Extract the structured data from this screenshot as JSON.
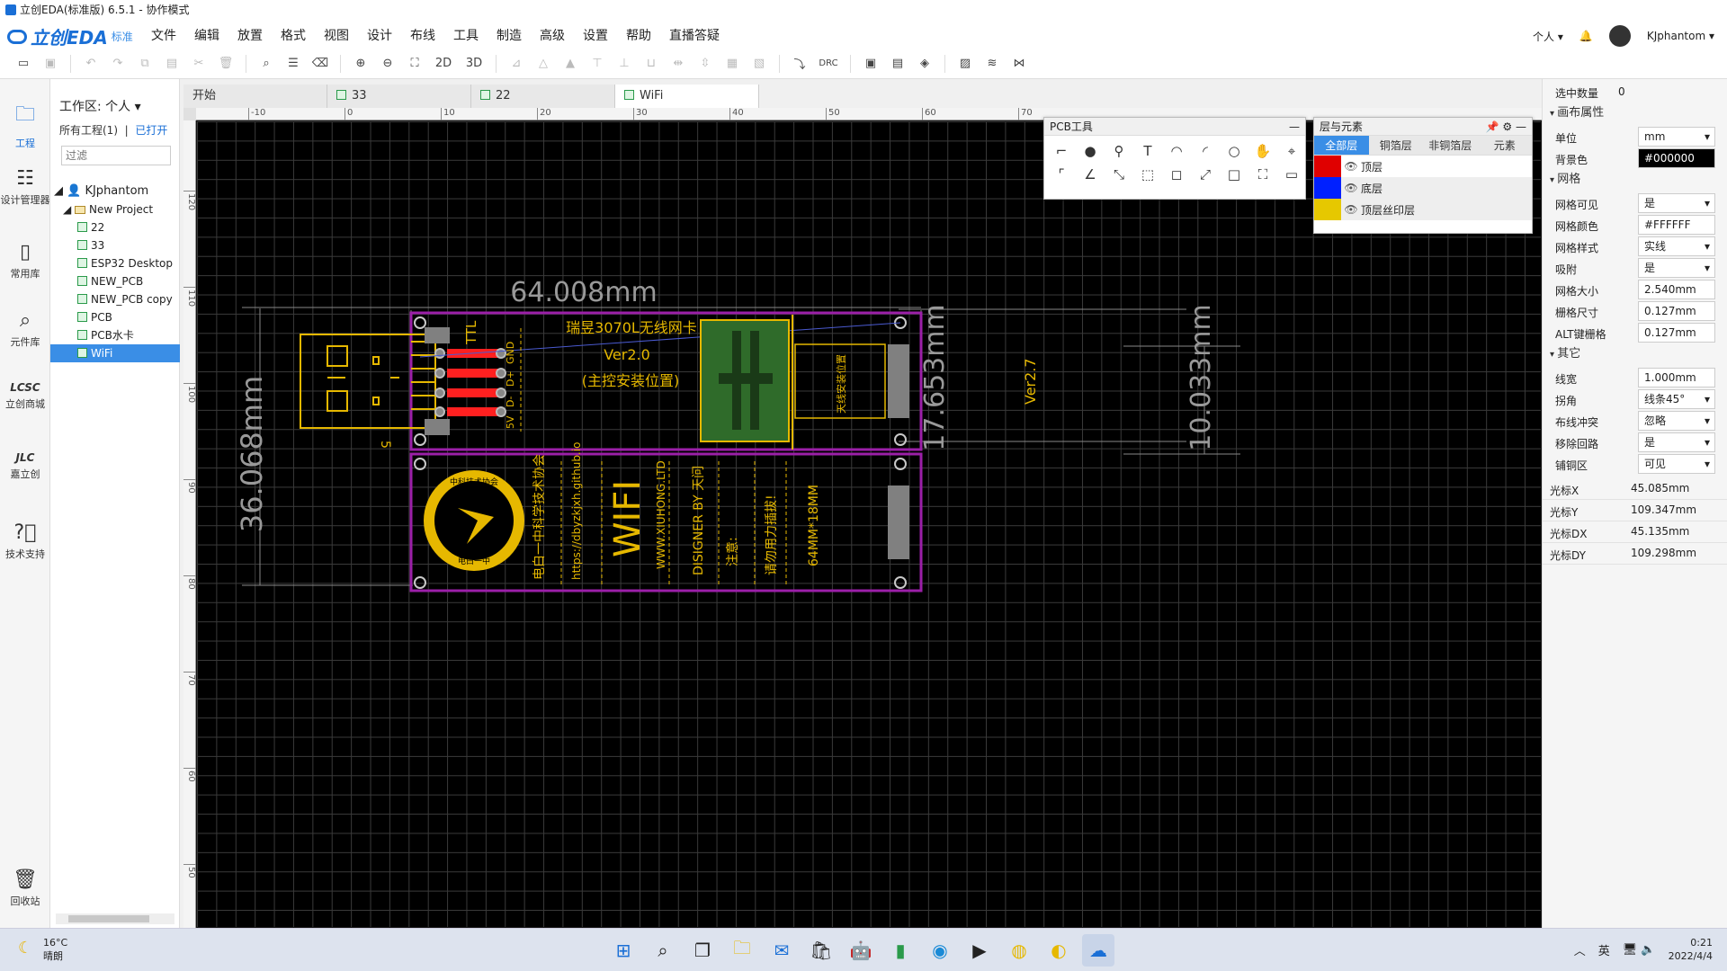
{
  "window": {
    "title": "立创EDA(标准版) 6.5.1 - 协作模式"
  },
  "brand": {
    "name": "立创EDA",
    "edition": "标准"
  },
  "menu": [
    "文件",
    "编辑",
    "放置",
    "格式",
    "视图",
    "设计",
    "布线",
    "工具",
    "制造",
    "高级",
    "设置",
    "帮助",
    "直播答疑"
  ],
  "user": {
    "mode": "个人",
    "name": "KJphantom"
  },
  "toolbar": {
    "view2d": "2D",
    "view3d": "3D",
    "drc": "DRC"
  },
  "leftnav": [
    {
      "id": "project",
      "label": "工程"
    },
    {
      "id": "design-manager",
      "label": "设计管理器"
    },
    {
      "id": "common-lib",
      "label": "常用库"
    },
    {
      "id": "component-lib",
      "label": "元件库"
    },
    {
      "id": "lcsc-mall",
      "label": "立创商城"
    },
    {
      "id": "jlc",
      "label": "嘉立创"
    },
    {
      "id": "support",
      "label": "技术支持"
    },
    {
      "id": "recycle",
      "label": "回收站"
    }
  ],
  "project_panel": {
    "workspace": "工作区: 个人",
    "all_projects": "所有工程(1)",
    "opened": "已打开",
    "filter_placeholder": "过滤",
    "owner": "KJphantom",
    "folder": "New Project",
    "files": [
      "22",
      "33",
      "ESP32 Desktop",
      "NEW_PCB",
      "NEW_PCB copy",
      "PCB",
      "PCB水卡",
      "WiFi"
    ],
    "selected": "WiFi"
  },
  "doc_tabs": [
    {
      "label": "开始",
      "icon": false
    },
    {
      "label": "33",
      "icon": true
    },
    {
      "label": "22",
      "icon": true
    },
    {
      "label": "WiFi",
      "icon": true,
      "active": true
    }
  ],
  "ruler_top": [
    "-10",
    "0",
    "10",
    "20",
    "30",
    "40",
    "50",
    "60",
    "70"
  ],
  "ruler_left": [
    "120",
    "110",
    "100",
    "90",
    "80",
    "70",
    "60",
    "50"
  ],
  "pcb": {
    "dim_width": "64.008mm",
    "dim_height": "36.068mm",
    "dim_right1": "17.653mm",
    "dim_right2": "10.033mm",
    "title": "瑞昱3070L无线网卡",
    "version": "Ver2.0",
    "subtitle": "(主控安装位置)",
    "ver27": "Ver2.7",
    "ttl": "TTL",
    "pins": [
      "GND",
      "D+",
      "D-",
      "5V"
    ],
    "antenna": "天线安装位置",
    "five": "5",
    "logo_ring": "中科技术协会",
    "logo_bottom": "电白一中",
    "silk_lines": [
      "电白一中科学技术协会",
      "https://dbyzkjxh.github.io",
      "WIFI",
      "WWW.XIUHONG.LTD",
      "DISIGNER BY 天问",
      "注意:",
      "请勿用力插拔!",
      "64MM*18MM"
    ],
    "colors": {
      "outline": "#9b1fa8",
      "silk": "#e6b800",
      "copper": "#ff2020",
      "green": "#2f6b2a",
      "pad": "#808080"
    }
  },
  "pcb_tools": {
    "title": "PCB工具",
    "icons": [
      "wire-icon",
      "circle-icon",
      "via-icon",
      "text-icon",
      "arc-icon",
      "arc2-icon",
      "circle2-icon",
      "hand-icon",
      "cross-icon",
      "image-icon",
      "line-icon",
      "angle-icon",
      "measure-icon",
      "dashed-rect-icon",
      "rect-corner-icon",
      "pin-icon",
      "rect-icon",
      "select-icon",
      "panel-icon"
    ]
  },
  "layers_panel": {
    "title": "层与元素",
    "tabs": [
      "全部层",
      "铜箔层",
      "非铜箔层",
      "元素"
    ],
    "layers": [
      {
        "name": "顶层",
        "color": "#e00000"
      },
      {
        "name": "底层",
        "color": "#0020ff"
      },
      {
        "name": "顶层丝印层",
        "color": "#e6c800"
      }
    ]
  },
  "props": {
    "selected_label": "选中数量",
    "selected_count": "0",
    "canvas_header": "画布属性",
    "rows1": [
      {
        "k": "单位",
        "v": "mm",
        "dd": true
      },
      {
        "k": "背景色",
        "v": "#000000",
        "black": true
      }
    ],
    "grid_header": "网格",
    "rows2": [
      {
        "k": "网格可见",
        "v": "是",
        "dd": true
      },
      {
        "k": "网格颜色",
        "v": "#FFFFFF"
      },
      {
        "k": "网格样式",
        "v": "实线",
        "dd": true
      },
      {
        "k": "吸附",
        "v": "是",
        "dd": true
      },
      {
        "k": "网格大小",
        "v": "2.540mm"
      },
      {
        "k": "栅格尺寸",
        "v": "0.127mm"
      },
      {
        "k": "ALT键栅格",
        "v": "0.127mm"
      }
    ],
    "other_header": "其它",
    "rows3": [
      {
        "k": "线宽",
        "v": "1.000mm"
      },
      {
        "k": "拐角",
        "v": "线条45°",
        "dd": true
      },
      {
        "k": "布线冲突",
        "v": "忽略",
        "dd": true
      },
      {
        "k": "移除回路",
        "v": "是",
        "dd": true
      },
      {
        "k": "铺铜区",
        "v": "可见",
        "dd": true
      }
    ],
    "cursor": [
      {
        "k": "光标X",
        "v": "45.085mm"
      },
      {
        "k": "光标Y",
        "v": "109.347mm"
      },
      {
        "k": "光标DX",
        "v": "45.135mm"
      },
      {
        "k": "光标DY",
        "v": "109.298mm"
      }
    ]
  },
  "taskbar": {
    "temp": "16°C",
    "weather": "晴朗",
    "ime": "英",
    "time": "0:21",
    "date": "2022/4/4"
  }
}
